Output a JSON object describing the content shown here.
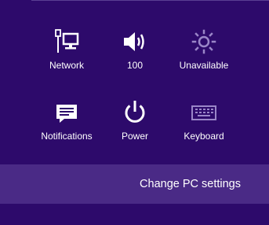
{
  "panel": {
    "tiles": [
      {
        "label": "Network",
        "icon": "network-icon"
      },
      {
        "label": "100",
        "icon": "volume-icon"
      },
      {
        "label": "Unavailable",
        "icon": "brightness-icon",
        "state": "disabled"
      },
      {
        "label": "Notifications",
        "icon": "notifications-icon"
      },
      {
        "label": "Power",
        "icon": "power-icon"
      },
      {
        "label": "Keyboard",
        "icon": "keyboard-icon",
        "state": "disabled"
      }
    ],
    "change_pc_settings_label": "Change PC settings"
  },
  "colors": {
    "background": "#2d0a6b",
    "settings_bar": "#4a2a86",
    "icon": "#ffffff",
    "disabled_icon": "#9a86c8"
  }
}
